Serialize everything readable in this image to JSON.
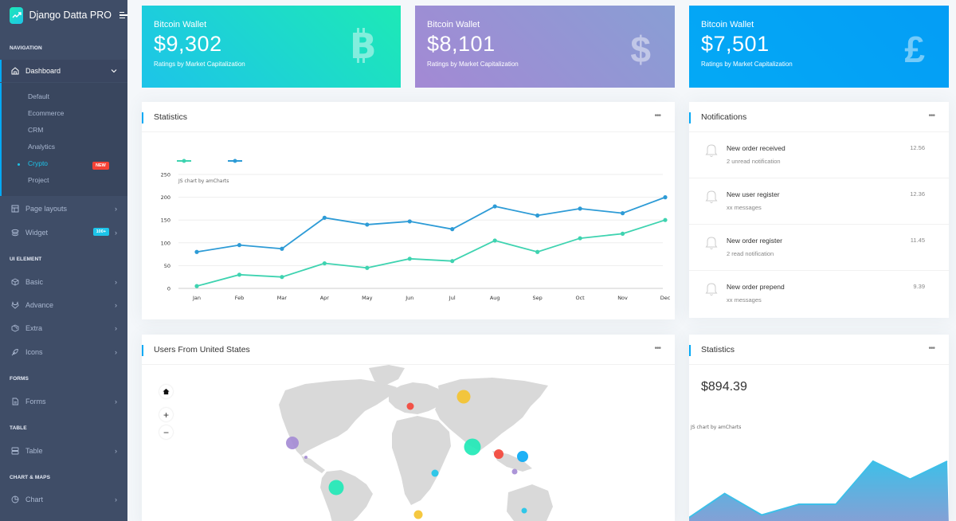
{
  "brand": {
    "title": "Django Datta PRO",
    "logo_icon": "trending-up-icon",
    "toggle_icon": "menu-icon"
  },
  "sidebar": {
    "captions": {
      "navigation": "NAVIGATION",
      "ui_element": "UI ELEMENT",
      "forms": "FORMS",
      "table": "TABLE",
      "chart_maps": "CHART & MAPS"
    },
    "dashboard": {
      "label": "Dashboard",
      "icon": "home-icon",
      "expanded": true
    },
    "dashboard_sub": [
      {
        "label": "Default"
      },
      {
        "label": "Ecommerce"
      },
      {
        "label": "CRM"
      },
      {
        "label": "Analytics"
      },
      {
        "label": "Crypto",
        "active": true,
        "badge": "NEW"
      },
      {
        "label": "Project"
      }
    ],
    "items": {
      "page_layouts": {
        "label": "Page layouts",
        "icon": "layout-icon"
      },
      "widget": {
        "label": "Widget",
        "icon": "layers-icon",
        "badge": "100+"
      },
      "basic": {
        "label": "Basic",
        "icon": "box-icon"
      },
      "advance": {
        "label": "Advance",
        "icon": "gitlab-icon"
      },
      "extra": {
        "label": "Extra",
        "icon": "package-icon"
      },
      "icons": {
        "label": "Icons",
        "icon": "feather-icon"
      },
      "forms": {
        "label": "Forms",
        "icon": "file-text-icon"
      },
      "table": {
        "label": "Table",
        "icon": "server-icon"
      },
      "chart": {
        "label": "Chart",
        "icon": "pie-chart-icon"
      }
    }
  },
  "wallets": [
    {
      "title": "Bitcoin Wallet",
      "value": "$9,302",
      "subtitle": "Ratings by Market Capitalization",
      "icon": "bitcoin-icon",
      "glyph": "B",
      "gradient": [
        "#1dc4e9",
        "#1de9b6"
      ]
    },
    {
      "title": "Bitcoin Wallet",
      "value": "$8,101",
      "subtitle": "Ratings by Market Capitalization",
      "icon": "dollar-icon",
      "glyph": "$",
      "gradient": [
        "#a389d4",
        "#899ed4"
      ]
    },
    {
      "title": "Bitcoin Wallet",
      "value": "$7,501",
      "subtitle": "Ratings by Market Capitalization",
      "icon": "pound-icon",
      "glyph": "£",
      "gradient": [
        "#04a9f5",
        "#049df5"
      ]
    }
  ],
  "statistics_card": {
    "title": "Statistics",
    "menu": "•••",
    "credit": "JS chart by amCharts"
  },
  "chart_data": {
    "type": "line",
    "title": "Statistics",
    "categories": [
      "Jan",
      "Feb",
      "Mar",
      "Apr",
      "May",
      "Jun",
      "Jul",
      "Aug",
      "Sep",
      "Oct",
      "Nov",
      "Dec"
    ],
    "series": [
      {
        "name": "",
        "color": "#3ed3b0",
        "values": [
          5,
          30,
          25,
          55,
          45,
          65,
          60,
          105,
          80,
          110,
          120,
          150
        ]
      },
      {
        "name": "",
        "color": "#2d9bd6",
        "values": [
          80,
          95,
          87,
          155,
          140,
          147,
          130,
          180,
          160,
          175,
          165,
          200
        ]
      }
    ],
    "yticks": [
      0,
      50,
      100,
      150,
      200,
      250
    ],
    "ylim": [
      0,
      250
    ],
    "xlabel": "",
    "ylabel": "",
    "grid": true,
    "legend": "top-left"
  },
  "notifications": {
    "title": "Notifications",
    "menu": "•••",
    "items": [
      {
        "title": "New order received",
        "subtitle": "2 unread notification",
        "time": "12.56"
      },
      {
        "title": "New user register",
        "subtitle": "xx messages",
        "time": "12.36"
      },
      {
        "title": "New order register",
        "subtitle": "2 read notification",
        "time": "11.45"
      },
      {
        "title": "New order prepend",
        "subtitle": "xx messages",
        "time": "9.39"
      }
    ]
  },
  "users_map": {
    "title": "Users From United States",
    "menu": "•••",
    "controls": {
      "home": "⌂",
      "zoom_in": "+",
      "zoom_out": "−"
    },
    "bubbles": [
      {
        "region": "Mexico",
        "color": "#a389d4"
      },
      {
        "region": "Central America",
        "color": "#a389d4"
      },
      {
        "region": "Brazil",
        "color": "#1de9b6"
      },
      {
        "region": "Europe",
        "color": "#f44236"
      },
      {
        "region": "Russia",
        "color": "#f4c22b"
      },
      {
        "region": "India",
        "color": "#1de9b6"
      },
      {
        "region": "Southeast Asia",
        "color": "#f44236"
      },
      {
        "region": "Philippines",
        "color": "#04a9f5"
      },
      {
        "region": "Indonesia",
        "color": "#a389d4"
      },
      {
        "region": "East Africa",
        "color": "#1dc4e9"
      },
      {
        "region": "South Africa",
        "color": "#f4c22b"
      },
      {
        "region": "Australia",
        "color": "#1dc4e9"
      }
    ]
  },
  "statistics_small": {
    "title": "Statistics",
    "menu": "•••",
    "value": "$894.39",
    "credit": "JS chart by amCharts",
    "area_values": [
      10,
      45,
      15,
      30,
      30,
      90,
      65,
      90
    ]
  }
}
